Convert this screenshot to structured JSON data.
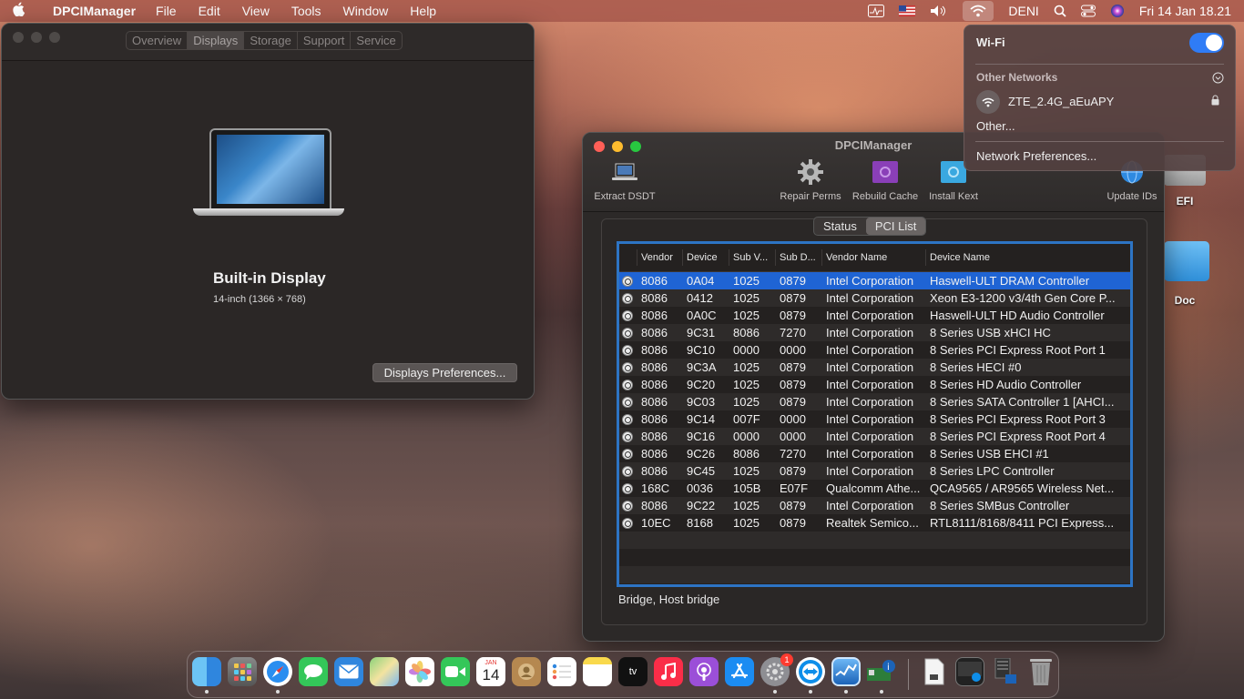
{
  "menubar": {
    "apple": "",
    "app_name": "DPCIManager",
    "menus": [
      "File",
      "Edit",
      "View",
      "Tools",
      "Window",
      "Help"
    ],
    "user": "DENI",
    "datetime": "Fri 14 Jan  18.21"
  },
  "about_window": {
    "tabs": [
      "Overview",
      "Displays",
      "Storage",
      "Support",
      "Service"
    ],
    "selected_tab": "Displays",
    "display_name": "Built-in Display",
    "display_spec": "14-inch (1366 × 768)",
    "prefs_button": "Displays Preferences..."
  },
  "dpci_window": {
    "title": "DPCIManager",
    "toolbar": {
      "extract": "Extract DSDT",
      "repair": "Repair Perms",
      "rebuild": "Rebuild Cache",
      "install": "Install Kext",
      "update": "Update IDs"
    },
    "tabs": [
      "Status",
      "PCI List"
    ],
    "selected_tab": "PCI List",
    "columns": [
      "Vendor",
      "Device",
      "Sub V...",
      "Sub D...",
      "Vendor Name",
      "Device Name"
    ],
    "rows": [
      [
        "8086",
        "0A04",
        "1025",
        "0879",
        "Intel Corporation",
        "Haswell-ULT DRAM Controller"
      ],
      [
        "8086",
        "0412",
        "1025",
        "0879",
        "Intel Corporation",
        "Xeon E3-1200 v3/4th Gen Core P..."
      ],
      [
        "8086",
        "0A0C",
        "1025",
        "0879",
        "Intel Corporation",
        "Haswell-ULT HD Audio Controller"
      ],
      [
        "8086",
        "9C31",
        "8086",
        "7270",
        "Intel Corporation",
        "8 Series USB xHCI HC"
      ],
      [
        "8086",
        "9C10",
        "0000",
        "0000",
        "Intel Corporation",
        "8 Series PCI Express Root Port 1"
      ],
      [
        "8086",
        "9C3A",
        "1025",
        "0879",
        "Intel Corporation",
        "8 Series HECI #0"
      ],
      [
        "8086",
        "9C20",
        "1025",
        "0879",
        "Intel Corporation",
        "8 Series HD Audio Controller"
      ],
      [
        "8086",
        "9C03",
        "1025",
        "0879",
        "Intel Corporation",
        "8 Series SATA Controller 1 [AHCI..."
      ],
      [
        "8086",
        "9C14",
        "007F",
        "0000",
        "Intel Corporation",
        "8 Series PCI Express Root Port 3"
      ],
      [
        "8086",
        "9C16",
        "0000",
        "0000",
        "Intel Corporation",
        "8 Series PCI Express Root Port 4"
      ],
      [
        "8086",
        "9C26",
        "8086",
        "7270",
        "Intel Corporation",
        "8 Series USB EHCI #1"
      ],
      [
        "8086",
        "9C45",
        "1025",
        "0879",
        "Intel Corporation",
        "8 Series LPC Controller"
      ],
      [
        "168C",
        "0036",
        "105B",
        "E07F",
        "Qualcomm Athe...",
        "QCA9565 / AR9565 Wireless Net..."
      ],
      [
        "8086",
        "9C22",
        "1025",
        "0879",
        "Intel Corporation",
        "8 Series SMBus Controller"
      ],
      [
        "10EC",
        "8168",
        "1025",
        "0879",
        "Realtek Semico...",
        "RTL8111/8168/8411 PCI Express..."
      ]
    ],
    "footer": "Bridge, Host bridge"
  },
  "wifi_menu": {
    "title": "Wi-Fi",
    "enabled": true,
    "other_networks_label": "Other Networks",
    "network": "ZTE_2.4G_aEuAPY",
    "other": "Other...",
    "prefs": "Network Preferences..."
  },
  "desktop": {
    "efi": "EFI",
    "doc": "Doc"
  },
  "dock": {
    "calendar_month": "JAN",
    "calendar_day": "14",
    "tv_label": "tv",
    "settings_badge": "1"
  }
}
